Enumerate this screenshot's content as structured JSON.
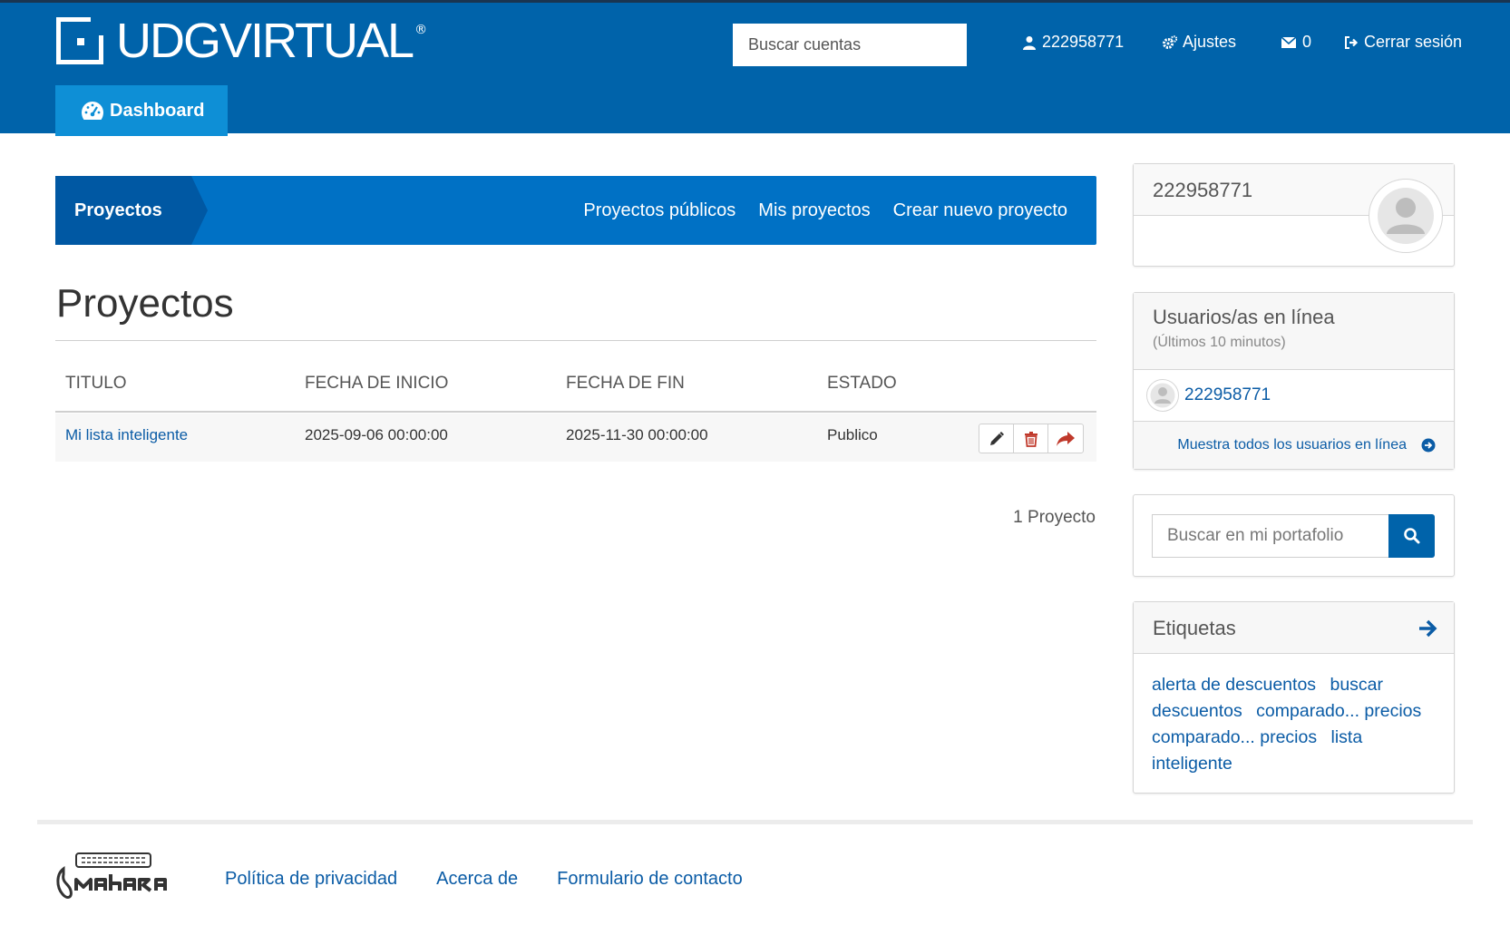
{
  "header": {
    "logo_text": "UDGVIRTUAL",
    "logo_reg": "®",
    "search_placeholder": "Buscar cuentas",
    "user_id": "222958771",
    "settings_label": "Ajustes",
    "messages_count": "0",
    "logout_label": "Cerrar sesión",
    "dashboard_label": "Dashboard"
  },
  "projects_bar": {
    "title": "Proyectos",
    "links": [
      "Proyectos públicos",
      "Mis proyectos",
      "Crear nuevo proyecto"
    ]
  },
  "main": {
    "title": "Proyectos",
    "columns": [
      "TITULO",
      "FECHA DE INICIO",
      "FECHA DE FIN",
      "ESTADO"
    ],
    "rows": [
      {
        "title": "Mi lista inteligente",
        "start": "2025-09-06 00:00:00",
        "end": "2025-11-30 00:00:00",
        "status": "Publico"
      }
    ],
    "count_label": "1 Proyecto"
  },
  "sidebar": {
    "profile_name": "222958771",
    "online_title": "Usuarios/as en línea",
    "online_subtitle": "(Últimos 10 minutos)",
    "online_user": "222958771",
    "online_all_label": "Muestra todos los usuarios en línea",
    "portfolio_search_placeholder": "Buscar en mi portafolio",
    "tags_title": "Etiquetas",
    "tags": [
      "alerta de descuentos",
      "buscar descuentos",
      "comparado... precios",
      "comparado... precios",
      "lista inteligente"
    ]
  },
  "footer": {
    "links": [
      "Política de privacidad",
      "Acerca de",
      "Formulario de contacto"
    ]
  },
  "colors": {
    "header_bg": "#0063aa",
    "dashboard_tab": "#0e8fd6",
    "projects_bar": "#0071c5",
    "projects_bar_active": "#0058a3",
    "link": "#0b5ca6"
  }
}
